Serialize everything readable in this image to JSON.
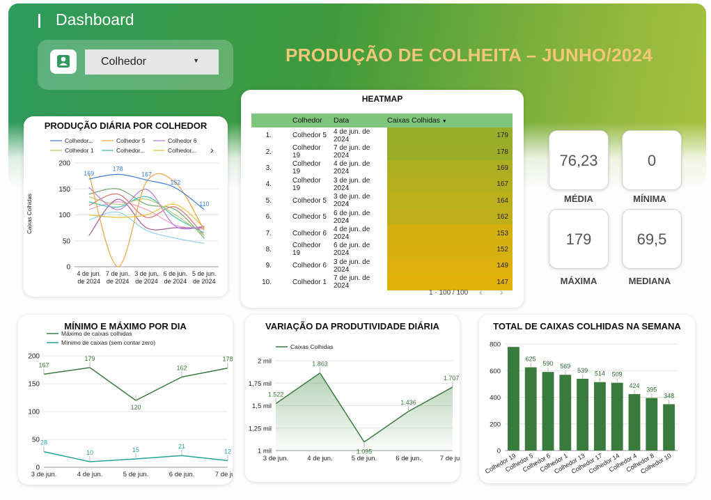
{
  "header": {
    "title": "Dashboard",
    "main_title": "PRODUÇÃO DE COLHEITA – JUNHO/2024"
  },
  "filter": {
    "label": "Colhedor",
    "icon": "person-icon"
  },
  "stats": [
    {
      "value": "76,23",
      "label": "MÉDIA"
    },
    {
      "value": "0",
      "label": "MÍNIMA"
    },
    {
      "value": "179",
      "label": "MÁXIMA"
    },
    {
      "value": "69,5",
      "label": "MEDIANA"
    }
  ],
  "heatmap": {
    "title": "HEATMAP",
    "columns": [
      "Colhedor",
      "Data",
      "Caixas Colhidas"
    ],
    "sort_icon": "sort-down-icon",
    "rows": [
      {
        "idx": "1.",
        "colhedor": "Colhedor 5",
        "data": "4 de jun. de 2024",
        "caixas": "179"
      },
      {
        "idx": "2.",
        "colhedor": "Colhedor 19",
        "data": "7 de jun. de 2024",
        "caixas": "178"
      },
      {
        "idx": "3.",
        "colhedor": "Colhedor 19",
        "data": "4 de jun. de 2024",
        "caixas": "169"
      },
      {
        "idx": "4.",
        "colhedor": "Colhedor 19",
        "data": "3 de jun. de 2024",
        "caixas": "167"
      },
      {
        "idx": "5.",
        "colhedor": "Colhedor 5",
        "data": "3 de jun. de 2024",
        "caixas": "164"
      },
      {
        "idx": "6.",
        "colhedor": "Colhedor 5",
        "data": "6 de jun. de 2024",
        "caixas": "162"
      },
      {
        "idx": "7.",
        "colhedor": "Colhedor 6",
        "data": "4 de jun. de 2024",
        "caixas": "153"
      },
      {
        "idx": "8.",
        "colhedor": "Colhedor 19",
        "data": "6 de jun. de 2024",
        "caixas": "152"
      },
      {
        "idx": "9.",
        "colhedor": "Colhedor 6",
        "data": "3 de jun. de 2024",
        "caixas": "149"
      },
      {
        "idx": "10.",
        "colhedor": "Colhedor 1",
        "data": "7 de jun. de 2024",
        "caixas": "147"
      }
    ],
    "pagination": "1 - 100 / 100"
  },
  "colors": {
    "accent_dark": "#3a7a3c",
    "teal": "#23a39a",
    "heat_high": "#98ad2a",
    "heat_low": "#e2b10b"
  },
  "chart_data": [
    {
      "type": "line",
      "title": "PRODUÇÃO DIÁRIA POR COLHEDOR",
      "ylabel": "Caixas Colhidas",
      "ylim": [
        0,
        200
      ],
      "yticks": [
        "0",
        "50",
        "100",
        "150",
        "200"
      ],
      "categories": [
        "4 de jun. de 2024",
        "7 de jun. de 2024",
        "3 de jun. de 2024",
        "6 de jun. de 2024",
        "5 de jun. de 2024"
      ],
      "legend": [
        "Colhedor...",
        "Colhedor 5",
        "Colhedor 6",
        "Colhedor 1",
        "Colhedor...",
        "Colhedor..."
      ],
      "series": [
        {
          "name": "Colhedor...",
          "color": "#3d7dd6",
          "values": [
            169,
            178,
            167,
            152,
            110
          ],
          "labels": [
            "169",
            "178",
            "167",
            "152",
            "110"
          ]
        },
        {
          "name": "Colhedor 5",
          "color": "#f2a03d",
          "values": [
            179,
            0,
            164,
            162,
            70
          ]
        },
        {
          "name": "Colhedor 6",
          "color": "#b27ad8",
          "values": [
            153,
            110,
            149,
            78,
            78
          ]
        },
        {
          "name": "Colhedor 1",
          "color": "#b7cc78",
          "values": [
            135,
            120,
            130,
            100,
            60
          ]
        },
        {
          "name": "Colhedor...",
          "color": "#3cc1b7",
          "values": [
            125,
            115,
            135,
            95,
            65
          ]
        },
        {
          "name": "Colhedor...",
          "color": "#e8c23c",
          "values": [
            100,
            95,
            100,
            120,
            75
          ]
        },
        {
          "color": "#e36f6f",
          "values": [
            118,
            140,
            95,
            115,
            60
          ]
        },
        {
          "color": "#6fa86f",
          "values": [
            140,
            150,
            120,
            110,
            55
          ]
        },
        {
          "color": "#9f5c9f",
          "values": [
            60,
            130,
            75,
            75,
            75
          ]
        },
        {
          "color": "#8fd0f0",
          "values": [
            90,
            105,
            70,
            55,
            45
          ]
        },
        {
          "color": "#f0a0c8",
          "values": [
            110,
            125,
            110,
            80,
            72
          ]
        }
      ]
    },
    {
      "type": "line",
      "title": "MÍNIMO E MÁXIMO POR DIA",
      "ylim": [
        0,
        200
      ],
      "yticks": [
        "0",
        "50",
        "100",
        "150",
        "200"
      ],
      "categories": [
        "3 de jun.",
        "4 de jun.",
        "5 de jun.",
        "6 de jun.",
        "7 de jun."
      ],
      "series": [
        {
          "name": "Máximo de caixas colhidas",
          "color": "#3a7a3c",
          "values": [
            167,
            179,
            120,
            162,
            178
          ],
          "labels": [
            "167",
            "179",
            "120",
            "162",
            "178"
          ]
        },
        {
          "name": "Mínimo de caixas (sem contar zero)",
          "color": "#23a39a",
          "values": [
            28,
            10,
            15,
            21,
            12
          ],
          "labels": [
            "28",
            "10",
            "15",
            "21",
            "12"
          ]
        }
      ]
    },
    {
      "type": "area",
      "title": "VARIAÇÃO DA PRODUTIVIDADE DIÁRIA",
      "ylim": [
        1000,
        2000
      ],
      "yticks": [
        "1 mil",
        "1,25 mil",
        "1,5 mil",
        "1,75 mil",
        "2 mil"
      ],
      "categories": [
        "3 de jun.",
        "4 de jun.",
        "5 de jun.",
        "6 de jun.",
        "7 de jun."
      ],
      "series": [
        {
          "name": "Caixas Colhidas",
          "color": "#3a7a3c",
          "values": [
            1522,
            1863,
            1095,
            1436,
            1707
          ],
          "labels": [
            "1.522",
            "1.863",
            "1.095",
            "1.436",
            "1.707"
          ]
        }
      ]
    },
    {
      "type": "bar",
      "title": "TOTAL DE CAIXAS COLHIDAS NA SEMANA",
      "ylim": [
        0,
        800
      ],
      "yticks": [
        "0",
        "200",
        "400",
        "600",
        "800"
      ],
      "color": "#3a7a3c",
      "categories": [
        "Colhedor 19",
        "Colhedor 5",
        "Colhedor 6",
        "Colhedor 1",
        "Colhedor 13",
        "Colhedor 17",
        "Colhedor 14",
        "Colhedor 4",
        "Colhedor 8",
        "Colhedor 10"
      ],
      "values": [
        778,
        625,
        590,
        569,
        539,
        514,
        509,
        424,
        395,
        348
      ],
      "labels": [
        "",
        "625",
        "590",
        "569",
        "539",
        "514",
        "509",
        "424",
        "395",
        "348"
      ]
    }
  ]
}
